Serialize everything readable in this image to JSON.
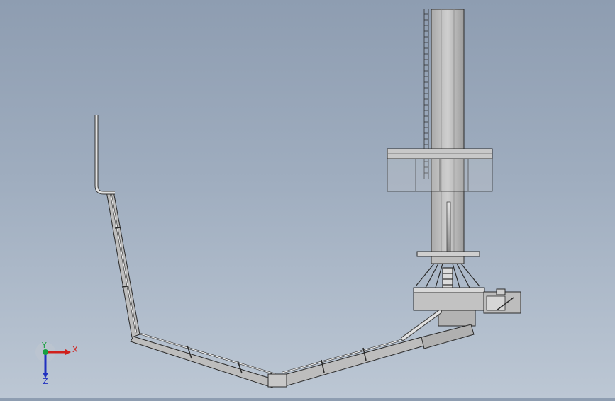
{
  "viewport": {
    "background_top": "#8e9db1",
    "background_bottom": "#bcc7d4"
  },
  "triad": {
    "x_label": "X",
    "y_label": "Y",
    "z_label": "Z",
    "x_color": "#d0201c",
    "y_color": "#18a040",
    "z_color": "#2030c0"
  },
  "model": {
    "icon": "tower-crane-with-boom-icon",
    "face_color": "#c4c4c4",
    "edge_color": "#2a2a2a"
  }
}
